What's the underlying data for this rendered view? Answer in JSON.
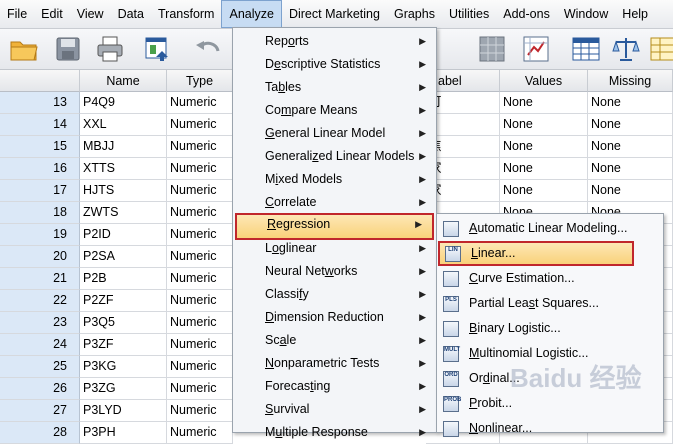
{
  "menubar": {
    "items": [
      "File",
      "Edit",
      "View",
      "Data",
      "Transform",
      "Analyze",
      "Direct Marketing",
      "Graphs",
      "Utilities",
      "Add-ons",
      "Window",
      "Help"
    ],
    "active": "Analyze"
  },
  "toolbar": {
    "icons": [
      "open-folder-icon",
      "save-icon",
      "print-icon",
      "dialog-recall-icon",
      "undo-icon",
      "split-icon",
      "weight-cases-icon",
      "value-labels-icon",
      "variable-sets-icon",
      "scales-icon",
      "table-icon"
    ]
  },
  "grid": {
    "headers": {
      "name": "Name",
      "type": "Type",
      "label": "abel",
      "values": "Values",
      "missing": "Missing"
    },
    "rows": [
      {
        "num": "13",
        "name": "P4Q9",
        "type": "Numeric",
        "label": "可",
        "values": "None",
        "missing": "None"
      },
      {
        "num": "14",
        "name": "XXL",
        "type": "Numeric",
        "label": "",
        "values": "None",
        "missing": "None"
      },
      {
        "num": "15",
        "name": "MBJJ",
        "type": "Numeric",
        "label": "焦",
        "values": "None",
        "missing": "None"
      },
      {
        "num": "16",
        "name": "XTTS",
        "type": "Numeric",
        "label": "家",
        "values": "None",
        "missing": "None"
      },
      {
        "num": "17",
        "name": "HJTS",
        "type": "Numeric",
        "label": "家",
        "values": "None",
        "missing": "None"
      },
      {
        "num": "18",
        "name": "ZWTS",
        "type": "Numeric",
        "label": "",
        "values": "None",
        "missing": "None"
      },
      {
        "num": "19",
        "name": "P2ID",
        "type": "Numeric",
        "label": "",
        "values": "",
        "missing": ""
      },
      {
        "num": "20",
        "name": "P2SA",
        "type": "Numeric",
        "label": "",
        "values": "",
        "missing": ""
      },
      {
        "num": "21",
        "name": "P2B",
        "type": "Numeric",
        "label": "",
        "values": "",
        "missing": ""
      },
      {
        "num": "22",
        "name": "P2ZF",
        "type": "Numeric",
        "label": "",
        "values": "",
        "missing": ""
      },
      {
        "num": "23",
        "name": "P3Q5",
        "type": "Numeric",
        "label": "",
        "values": "",
        "missing": ""
      },
      {
        "num": "24",
        "name": "P3ZF",
        "type": "Numeric",
        "label": "",
        "values": "",
        "missing": ""
      },
      {
        "num": "25",
        "name": "P3KG",
        "type": "Numeric",
        "label": "",
        "values": "",
        "missing": ""
      },
      {
        "num": "26",
        "name": "P3ZG",
        "type": "Numeric",
        "label": "",
        "values": "",
        "missing": ""
      },
      {
        "num": "27",
        "name": "P3LYD",
        "type": "Numeric",
        "label": "",
        "values": "",
        "missing": ""
      },
      {
        "num": "28",
        "name": "P3PH",
        "type": "Numeric",
        "label": "",
        "values": "",
        "missing": ""
      }
    ]
  },
  "analyze_menu": {
    "items": [
      {
        "pre": "Rep",
        "u": "o",
        "post": "rts",
        "arrow": true
      },
      {
        "pre": "D",
        "u": "e",
        "post": "scriptive Statistics",
        "arrow": true
      },
      {
        "pre": "Ta",
        "u": "b",
        "post": "les",
        "arrow": true
      },
      {
        "pre": "Co",
        "u": "m",
        "post": "pare Means",
        "arrow": true
      },
      {
        "pre": "",
        "u": "G",
        "post": "eneral Linear Model",
        "arrow": true
      },
      {
        "pre": "Generali",
        "u": "z",
        "post": "ed Linear Models",
        "arrow": true
      },
      {
        "pre": "M",
        "u": "i",
        "post": "xed Models",
        "arrow": true
      },
      {
        "pre": "",
        "u": "C",
        "post": "orrelate",
        "arrow": true
      },
      {
        "pre": "",
        "u": "R",
        "post": "egression",
        "arrow": true
      },
      {
        "pre": "L",
        "u": "o",
        "post": "glinear",
        "arrow": true
      },
      {
        "pre": "Neural Net",
        "u": "w",
        "post": "orks",
        "arrow": true
      },
      {
        "pre": "Classi",
        "u": "f",
        "post": "y",
        "arrow": true
      },
      {
        "pre": "",
        "u": "D",
        "post": "imension Reduction",
        "arrow": true
      },
      {
        "pre": "Sc",
        "u": "a",
        "post": "le",
        "arrow": true
      },
      {
        "pre": "",
        "u": "N",
        "post": "onparametric Tests",
        "arrow": true
      },
      {
        "pre": "Forecas",
        "u": "t",
        "post": "ing",
        "arrow": true
      },
      {
        "pre": "",
        "u": "S",
        "post": "urvival",
        "arrow": true
      },
      {
        "pre": "M",
        "u": "u",
        "post": "ltiple Response",
        "arrow": true
      }
    ],
    "selected_index": 8
  },
  "regression_submenu": {
    "items": [
      {
        "pre": "",
        "u": "A",
        "post": "utomatic Linear Modeling...",
        "icon": "automatic-linear-modeling-icon",
        "code": ""
      },
      {
        "pre": "",
        "u": "L",
        "post": "inear...",
        "icon": "linear-regression-icon",
        "code": "LIN"
      },
      {
        "pre": "",
        "u": "C",
        "post": "urve Estimation...",
        "icon": "curve-estimation-icon",
        "code": ""
      },
      {
        "pre": "Partial Lea",
        "u": "s",
        "post": "t Squares...",
        "icon": "partial-least-squares-icon",
        "code": "PLS"
      },
      {
        "pre": "",
        "u": "B",
        "post": "inary Logistic...",
        "icon": "binary-logistic-icon",
        "code": ""
      },
      {
        "pre": "",
        "u": "M",
        "post": "ultinomial Logistic...",
        "icon": "multinomial-logistic-icon",
        "code": "MULT"
      },
      {
        "pre": "Or",
        "u": "d",
        "post": "inal...",
        "icon": "ordinal-regression-icon",
        "code": "ORD"
      },
      {
        "pre": "",
        "u": "P",
        "post": "robit...",
        "icon": "probit-icon",
        "code": "PROB"
      },
      {
        "pre": "",
        "u": "N",
        "post": "onlinear...",
        "icon": "nonlinear-regression-icon",
        "code": ""
      }
    ],
    "selected_index": 1
  },
  "colors": {
    "highlight_border": "#c0262c",
    "highlight_fill": "#f9d27a",
    "rownum_bg": "#dbe8f7"
  }
}
